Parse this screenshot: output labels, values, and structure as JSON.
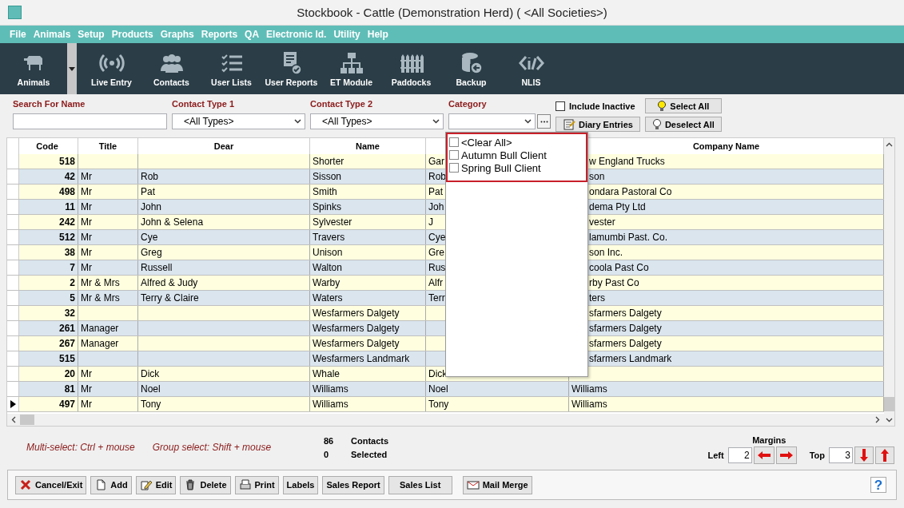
{
  "window": {
    "title": "Stockbook - Cattle (Demonstration Herd) ( <All Societies>)"
  },
  "menu": [
    {
      "label": "File"
    },
    {
      "label": "Animals"
    },
    {
      "label": "Setup"
    },
    {
      "label": "Products"
    },
    {
      "label": "Graphs"
    },
    {
      "label": "Reports"
    },
    {
      "label": "QA"
    },
    {
      "label": "Electronic Id."
    },
    {
      "label": "Utility"
    },
    {
      "label": "Help"
    }
  ],
  "toolbar": [
    {
      "label": "Animals"
    },
    {
      "label": "Live Entry"
    },
    {
      "label": "Contacts"
    },
    {
      "label": "User Lists"
    },
    {
      "label": "User Reports"
    },
    {
      "label": "ET Module"
    },
    {
      "label": "Paddocks"
    },
    {
      "label": "Backup"
    },
    {
      "label": "NLIS"
    }
  ],
  "filters": {
    "search": {
      "label": "Search For Name"
    },
    "contact_type_1": {
      "label": "Contact Type 1",
      "value": "<All Types>"
    },
    "contact_type_2": {
      "label": "Contact Type 2",
      "value": "<All Types>"
    },
    "category": {
      "label": "Category"
    },
    "include_inactive": {
      "label": "Include Inactive",
      "checked": false
    },
    "buttons": [
      {
        "label": "Select All"
      },
      {
        "label": "Diary Entries"
      },
      {
        "label": "Deselect All"
      }
    ]
  },
  "category_list": [
    {
      "label": "<Clear All>",
      "checked": false
    },
    {
      "label": "Autumn Bull Client",
      "checked": false
    },
    {
      "label": "Spring Bull Client",
      "checked": false
    }
  ],
  "table": {
    "columns": [
      "Code",
      "Title",
      "Dear",
      "Name",
      "",
      "Company Name"
    ],
    "rows": [
      {
        "current": false,
        "cells": [
          "518",
          "",
          "",
          "Shorter",
          "Gar",
          "w England Trucks"
        ]
      },
      {
        "current": false,
        "cells": [
          "42",
          "Mr",
          "Rob",
          "Sisson",
          "Rob",
          "son"
        ]
      },
      {
        "current": false,
        "cells": [
          "498",
          "Mr",
          "Pat",
          "Smith",
          "Pat",
          "ondara Pastoral Co"
        ]
      },
      {
        "current": false,
        "cells": [
          "11",
          "Mr",
          "John",
          "Spinks",
          "Joh",
          "dema Pty Ltd"
        ]
      },
      {
        "current": false,
        "cells": [
          "242",
          "Mr",
          "John & Selena",
          "Sylvester",
          "J",
          "vester"
        ]
      },
      {
        "current": false,
        "cells": [
          "512",
          "Mr",
          "Cye",
          "Travers",
          "Cye",
          "lamumbi Past. Co."
        ]
      },
      {
        "current": false,
        "cells": [
          "38",
          "Mr",
          "Greg",
          "Unison",
          "Gre",
          "son Inc."
        ]
      },
      {
        "current": false,
        "cells": [
          "7",
          "Mr",
          "Russell",
          "Walton",
          "Rus",
          "coola Past Co"
        ]
      },
      {
        "current": false,
        "cells": [
          "2",
          "Mr & Mrs",
          "Alfred & Judy",
          "Warby",
          "Alfr",
          "rby Past Co"
        ]
      },
      {
        "current": false,
        "cells": [
          "5",
          "Mr & Mrs",
          "Terry & Claire",
          "Waters",
          "Terr",
          "ters"
        ]
      },
      {
        "current": false,
        "cells": [
          "32",
          "",
          "",
          "Wesfarmers Dalgety",
          "",
          "sfarmers Dalgety"
        ]
      },
      {
        "current": false,
        "cells": [
          "261",
          "Manager",
          "",
          "Wesfarmers Dalgety",
          "",
          "sfarmers Dalgety"
        ]
      },
      {
        "current": false,
        "cells": [
          "267",
          "Manager",
          "",
          "Wesfarmers Dalgety",
          "",
          "sfarmers Dalgety"
        ]
      },
      {
        "current": false,
        "cells": [
          "515",
          "",
          "",
          "Wesfarmers Landmark",
          "",
          "sfarmers Landmark"
        ]
      },
      {
        "current": false,
        "cells": [
          "20",
          "Mr",
          "Dick",
          "Whale",
          "Dick",
          ""
        ]
      },
      {
        "current": false,
        "cells": [
          "81",
          "Mr",
          "Noel",
          "Williams",
          "Noel",
          "Williams"
        ]
      },
      {
        "current": true,
        "cells": [
          "497",
          "Mr",
          "Tony",
          "Williams",
          "Tony",
          "Williams"
        ]
      }
    ]
  },
  "status": {
    "hints": [
      "Multi-select: Ctrl + mouse",
      "Group select: Shift + mouse"
    ],
    "counts": [
      {
        "value": "86",
        "label": "Contacts"
      },
      {
        "value": "0",
        "label": "Selected"
      }
    ],
    "margins": {
      "title": "Margins",
      "left": {
        "label": "Left",
        "value": "2"
      },
      "top": {
        "label": "Top",
        "value": "3"
      }
    }
  },
  "buttons": [
    {
      "label": "Cancel/Exit"
    },
    {
      "label": "Add"
    },
    {
      "label": "Edit"
    },
    {
      "label": "Delete"
    },
    {
      "label": "Print"
    },
    {
      "label": "Labels"
    },
    {
      "label": "Sales Report"
    },
    {
      "label": "Sales List"
    },
    {
      "label": "Mail Merge"
    }
  ],
  "help": {
    "label": "?"
  }
}
